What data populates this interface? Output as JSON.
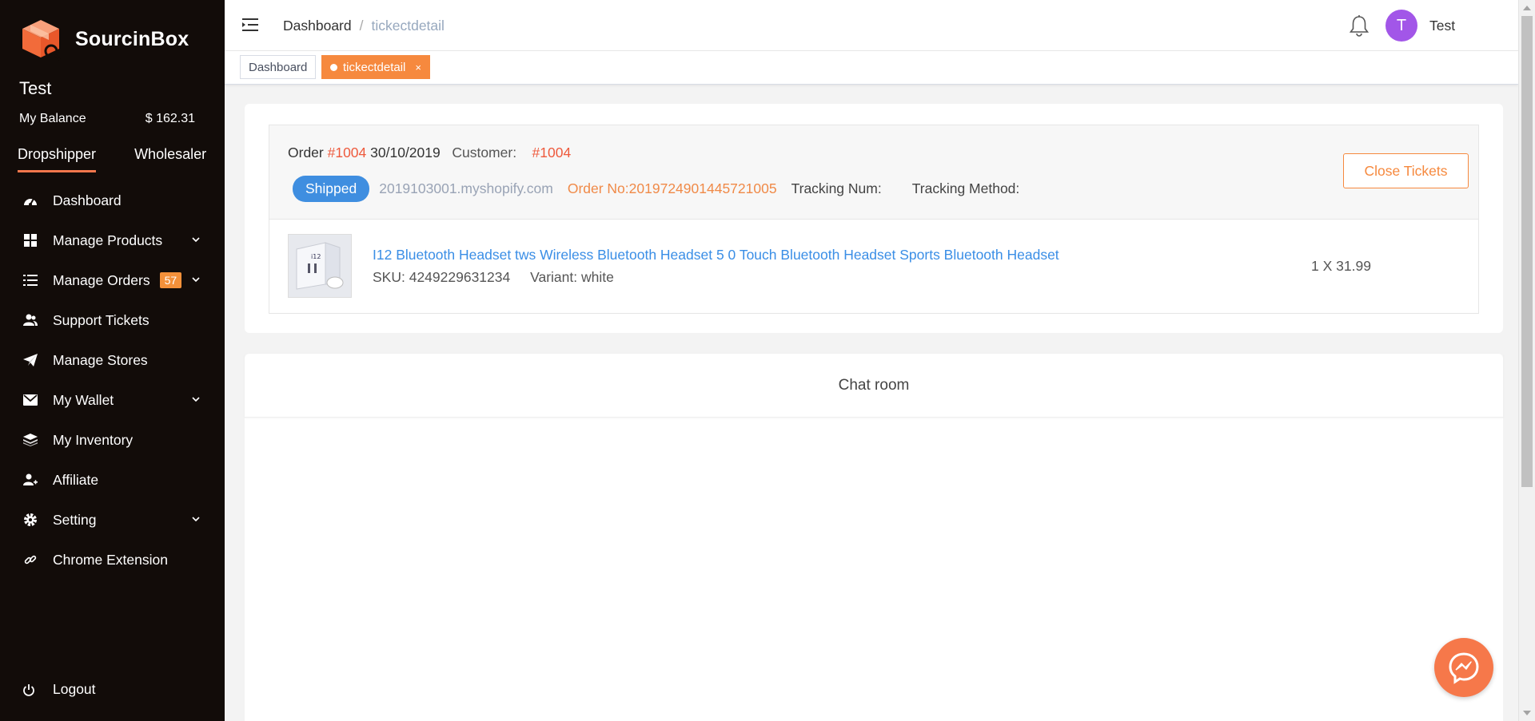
{
  "brand": {
    "name": "SourcinBox"
  },
  "user": {
    "name": "Test",
    "balance_label": "My Balance",
    "balance_value": "$ 162.31"
  },
  "modes": [
    "Dropshipper",
    "Wholesaler"
  ],
  "menu": [
    {
      "label": "Dashboard"
    },
    {
      "label": "Manage Products"
    },
    {
      "label": "Manage Orders",
      "badge": "57"
    },
    {
      "label": "Support Tickets"
    },
    {
      "label": "Manage Stores"
    },
    {
      "label": "My Wallet"
    },
    {
      "label": "My Inventory"
    },
    {
      "label": "Affiliate"
    },
    {
      "label": "Setting"
    },
    {
      "label": "Chrome Extension"
    }
  ],
  "logout_label": "Logout",
  "header": {
    "breadcrumb": [
      "Dashboard",
      "/",
      "tickectdetail"
    ],
    "avatar_letter": "T",
    "user": "Test"
  },
  "tags": [
    {
      "label": "Dashboard"
    },
    {
      "label": "tickectdetail",
      "close": "×"
    }
  ],
  "order": {
    "prefix": "Order",
    "id": "#1004",
    "date": "30/10/2019",
    "customer_label": "Customer:",
    "customer_id": "#1004",
    "status": "Shipped",
    "store": "2019103001.myshopify.com",
    "order_no": "Order No:2019724901445721005",
    "tracking_num_label": "Tracking Num:",
    "tracking_method_label": "Tracking Method:",
    "close_button": "Close Tickets"
  },
  "item": {
    "title": "I12 Bluetooth Headset tws Wireless Bluetooth Headset 5 0 Touch Bluetooth Headset Sports Bluetooth Headset",
    "sku": "SKU: 4249229631234",
    "variant": "Variant: white",
    "qty_price": "1 X 31.99",
    "thumb_text": "i12"
  },
  "chat": {
    "title": "Chat room"
  },
  "colors": {
    "accent": "#f6893e",
    "sidebar_bg": "#120c09",
    "link": "#3a8ee6",
    "status": "#3f8ee0",
    "red": "#ee5a3d"
  }
}
